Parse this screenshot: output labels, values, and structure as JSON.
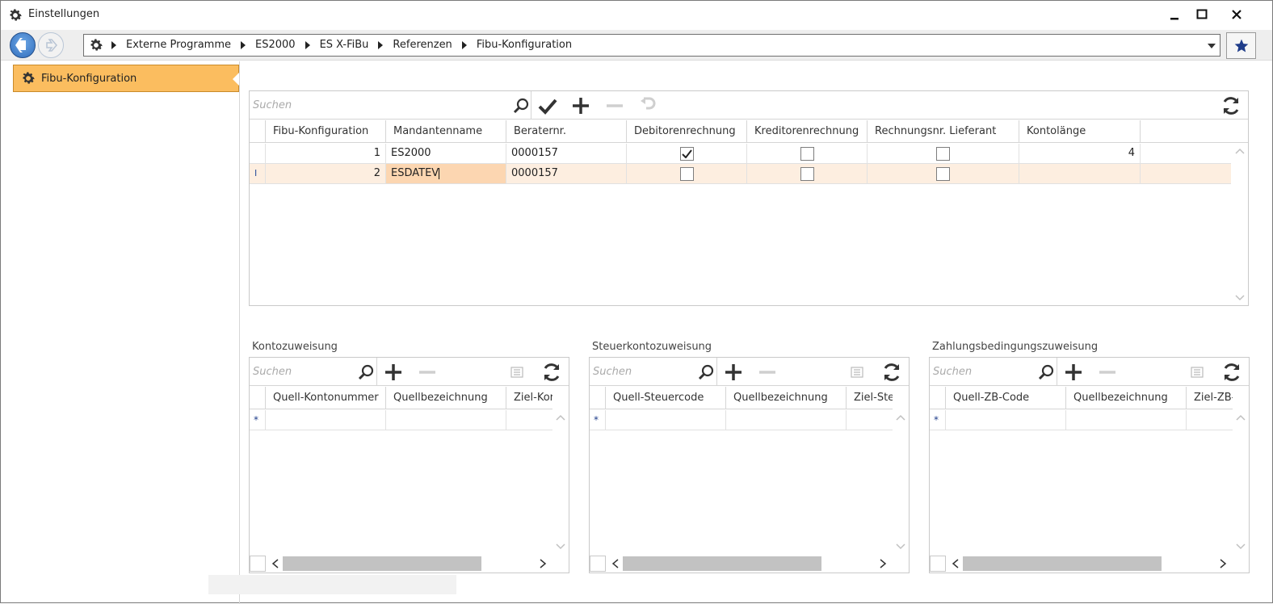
{
  "window": {
    "title": "Einstellungen",
    "controls": [
      "minimize",
      "maximize",
      "close"
    ]
  },
  "breadcrumb": {
    "items": [
      "Externe Programme",
      "ES2000",
      "ES X-FiBu",
      "Referenzen",
      "Fibu-Konfiguration"
    ]
  },
  "sidebar": {
    "items": [
      {
        "label": "Fibu-Konfiguration",
        "icon": "gear-icon",
        "selected": true
      }
    ]
  },
  "main_grid": {
    "search_placeholder": "Suchen",
    "columns": [
      "Fibu-Konfiguration",
      "Mandantenname",
      "Beraternr.",
      "Debitorenrechnung",
      "Kreditorenrechnung",
      "Rechnungsnr. Lieferant",
      "Kontolänge"
    ],
    "rows": [
      {
        "indicator": "",
        "id": "1",
        "name": "ES2000",
        "berater": "0000157",
        "debitor": true,
        "kreditor": false,
        "lieferant": false,
        "kontolaenge": "4"
      },
      {
        "indicator": "I",
        "id": "2",
        "name": "ESDATEV",
        "berater": "0000157",
        "debitor": false,
        "kreditor": false,
        "lieferant": false,
        "kontolaenge": ""
      }
    ],
    "selected_row": 1
  },
  "sub_grids": [
    {
      "title": "Kontozuweisung",
      "search_placeholder": "Suchen",
      "columns": [
        "Quell-Kontonummer",
        "Quellbezeichnung",
        "Ziel-Kor"
      ],
      "new_row_marker": "*"
    },
    {
      "title": "Steuerkontozuweisung",
      "search_placeholder": "Suchen",
      "columns": [
        "Quell-Steuercode",
        "Quellbezeichnung",
        "Ziel-Ste"
      ],
      "new_row_marker": "*"
    },
    {
      "title": "Zahlungsbedingungszuweisung",
      "search_placeholder": "Suchen",
      "columns": [
        "Quell-ZB-Code",
        "Quellbezeichnung",
        "Ziel-ZB-"
      ],
      "new_row_marker": "*"
    }
  ],
  "colors": {
    "accent_selection": "#fbbd5f",
    "row_selection": "#fdeee0",
    "cell_edit": "#fcd6b1",
    "nav_back": "#2f6cbc",
    "star": "#1f3d8a",
    "new_row_marker": "#1f3d8a"
  }
}
